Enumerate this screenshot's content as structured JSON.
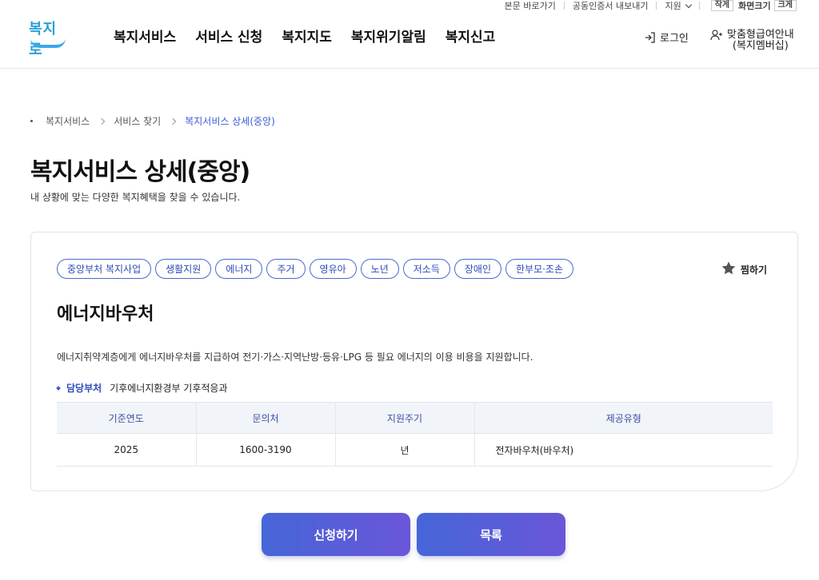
{
  "util": {
    "skip_link": "본문 바로가기",
    "cert_export": "공동인증서 내보내기",
    "lang": "지원",
    "small": "작게",
    "size_label": "화면크기",
    "large": "크게"
  },
  "logo": {
    "text": "복지로"
  },
  "gnb": [
    "복지서비스",
    "서비스 신청",
    "복지지도",
    "복지위기알림",
    "복지신고"
  ],
  "header": {
    "login": "로그인",
    "member_line1": "맞춤형급여안내",
    "member_line2": "(복지멤버십)"
  },
  "breadcrumb": [
    "복지서비스",
    "서비스 찾기",
    "복지서비스 상세(중앙)"
  ],
  "page": {
    "title": "복지서비스 상세(중앙)",
    "subtitle": "내 상황에 맞는 다양한 복지혜택을 찾을 수 있습니다."
  },
  "card": {
    "tags": [
      "중앙부처 복지사업",
      "생활지원",
      "에너지",
      "주거",
      "영유아",
      "노년",
      "저소득",
      "장애인",
      "한부모·조손"
    ],
    "favorite": "찜하기",
    "service_name": "에너지바우처",
    "description": "에너지취약계층에게 에너지바우처를 지급하여 전기·가스·지역난방·등유·LPG 등 필요 에너지의 이용 비용을 지원합니다.",
    "dept_label": "담당부처",
    "dept_value": "기후에너지환경부 기후적응과",
    "table": {
      "headers": [
        "기준연도",
        "문의처",
        "지원주기",
        "제공유형"
      ],
      "row": [
        "2025",
        "1600-3190",
        "년",
        "전자바우처(바우처)"
      ]
    }
  },
  "buttons": {
    "apply": "신청하기",
    "list": "목록"
  },
  "colors": {
    "accent": "#3d5bd8",
    "logo": "#2a9fd8"
  }
}
